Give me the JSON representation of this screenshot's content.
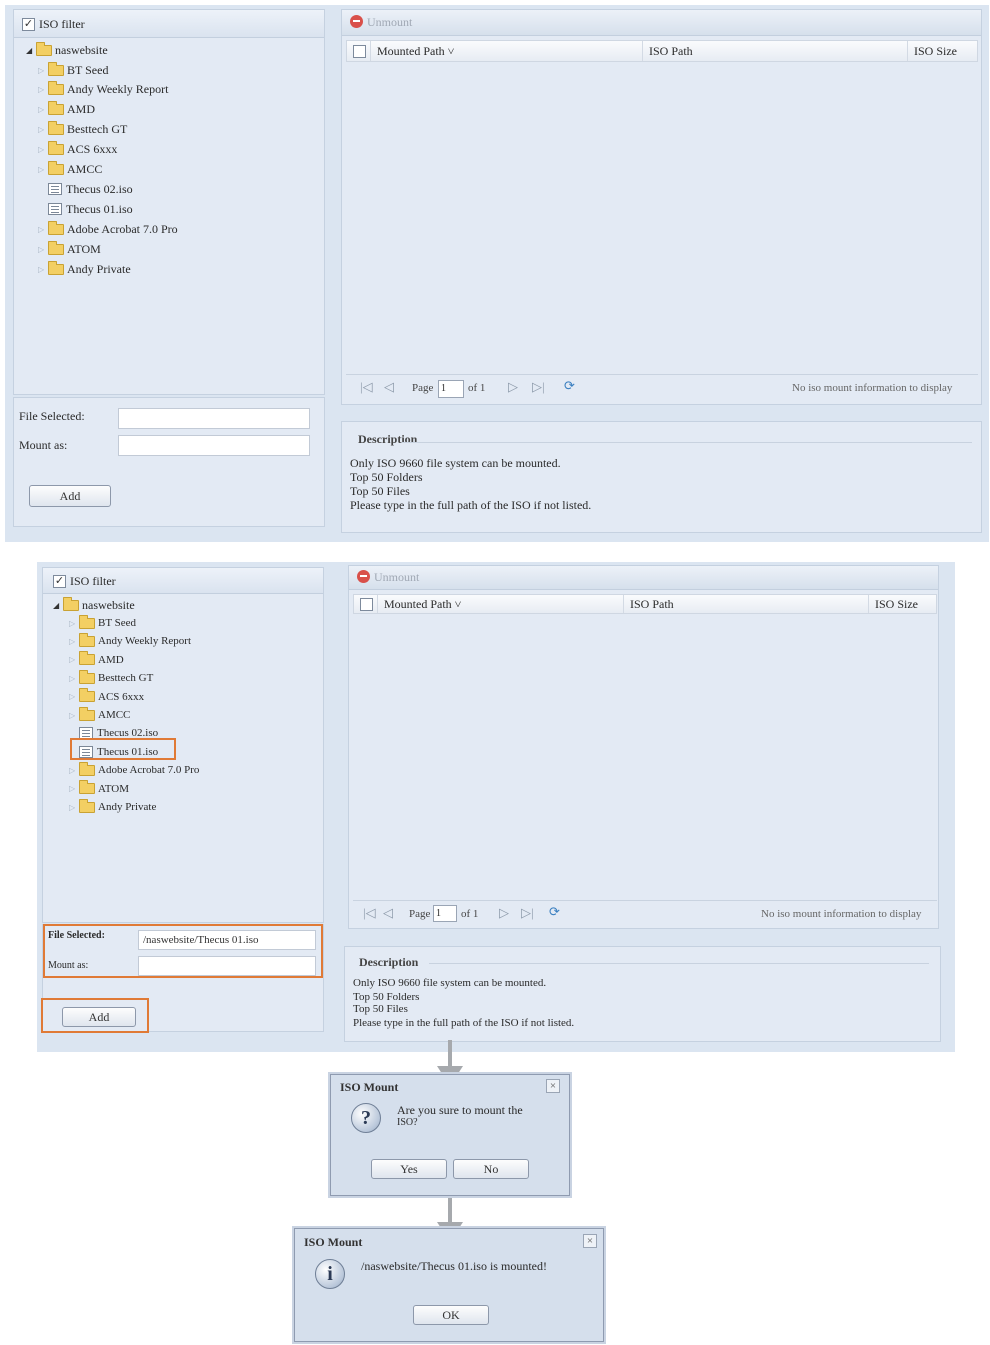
{
  "screen1": {
    "tree": {
      "filter_label": "ISO filter",
      "root_label": "naswebsite",
      "items": [
        {
          "type": "folder",
          "label": "BT Seed"
        },
        {
          "type": "folder",
          "label": "Andy Weekly Report"
        },
        {
          "type": "folder",
          "label": "AMD"
        },
        {
          "type": "folder",
          "label": "Besttech GT"
        },
        {
          "type": "folder",
          "label": "ACS 6xxx"
        },
        {
          "type": "folder",
          "label": "AMCC"
        },
        {
          "type": "file",
          "label": "Thecus 02.iso"
        },
        {
          "type": "file",
          "label": "Thecus 01.iso"
        },
        {
          "type": "folder",
          "label": "Adobe Acrobat 7.0 Pro"
        },
        {
          "type": "folder",
          "label": "ATOM"
        },
        {
          "type": "folder",
          "label": "Andy Private"
        }
      ]
    },
    "form": {
      "file_selected_label": "File Selected:",
      "file_selected_value": "",
      "mount_as_label": "Mount as:",
      "mount_as_value": "",
      "add_label": "Add"
    },
    "toolbar": {
      "unmount_label": "Unmount"
    },
    "grid": {
      "columns": [
        "Mounted Path ˅",
        "ISO Path",
        "ISO Size"
      ]
    },
    "pager": {
      "page_label": "Page",
      "page_value": "1",
      "of_label": "of 1",
      "status": "No iso mount information to display"
    },
    "description": {
      "title": "Description",
      "lines": [
        "Only ISO 9660 file system can be mounted.",
        "Top 50 Folders",
        "Top 50 Files",
        "Please type in the full path of the ISO if not listed."
      ]
    }
  },
  "screen2": {
    "tree": {
      "filter_label": "ISO filter",
      "root_label": "naswebsite",
      "items": [
        {
          "type": "folder",
          "label": "BT Seed"
        },
        {
          "type": "folder",
          "label": "Andy Weekly Report"
        },
        {
          "type": "folder",
          "label": "AMD"
        },
        {
          "type": "folder",
          "label": "Besttech GT"
        },
        {
          "type": "folder",
          "label": "ACS 6xxx"
        },
        {
          "type": "folder",
          "label": "AMCC"
        },
        {
          "type": "file",
          "label": "Thecus 02.iso"
        },
        {
          "type": "file",
          "label": "Thecus 01.iso"
        },
        {
          "type": "folder",
          "label": "Adobe Acrobat 7.0 Pro"
        },
        {
          "type": "folder",
          "label": "ATOM"
        },
        {
          "type": "folder",
          "label": "Andy Private"
        }
      ]
    },
    "form": {
      "file_selected_label": "File Selected:",
      "file_selected_value": "/naswebsite/Thecus 01.iso",
      "mount_as_label": "Mount as:",
      "mount_as_value": "",
      "add_label": "Add"
    },
    "toolbar": {
      "unmount_label": "Unmount"
    },
    "grid": {
      "columns": [
        "Mounted Path ˅",
        "ISO Path",
        "ISO Size"
      ]
    },
    "pager": {
      "page_label": "Page",
      "page_value": "1",
      "of_label": "of 1",
      "status": "No iso mount information to display"
    },
    "description": {
      "title": "Description",
      "lines": [
        "Only ISO 9660 file system can be mounted.",
        "Top 50 Folders",
        "Top 50 Files",
        "Please type in the full path of the ISO if not listed."
      ]
    }
  },
  "confirm_dialog": {
    "title": "ISO Mount",
    "message_line1": "Are you sure to mount the",
    "message_line2": "ISO?",
    "yes_label": "Yes",
    "no_label": "No",
    "close_glyph": "×",
    "icon_glyph": "?"
  },
  "result_dialog": {
    "title": "ISO Mount",
    "message": "/naswebsite/Thecus 01.iso is mounted!",
    "ok_label": "OK",
    "close_glyph": "×",
    "icon_glyph": "i"
  },
  "colors": {
    "highlight": "#e07a36",
    "panel_bg": "#e3eaf4",
    "arrow": "#a6a9ad"
  }
}
